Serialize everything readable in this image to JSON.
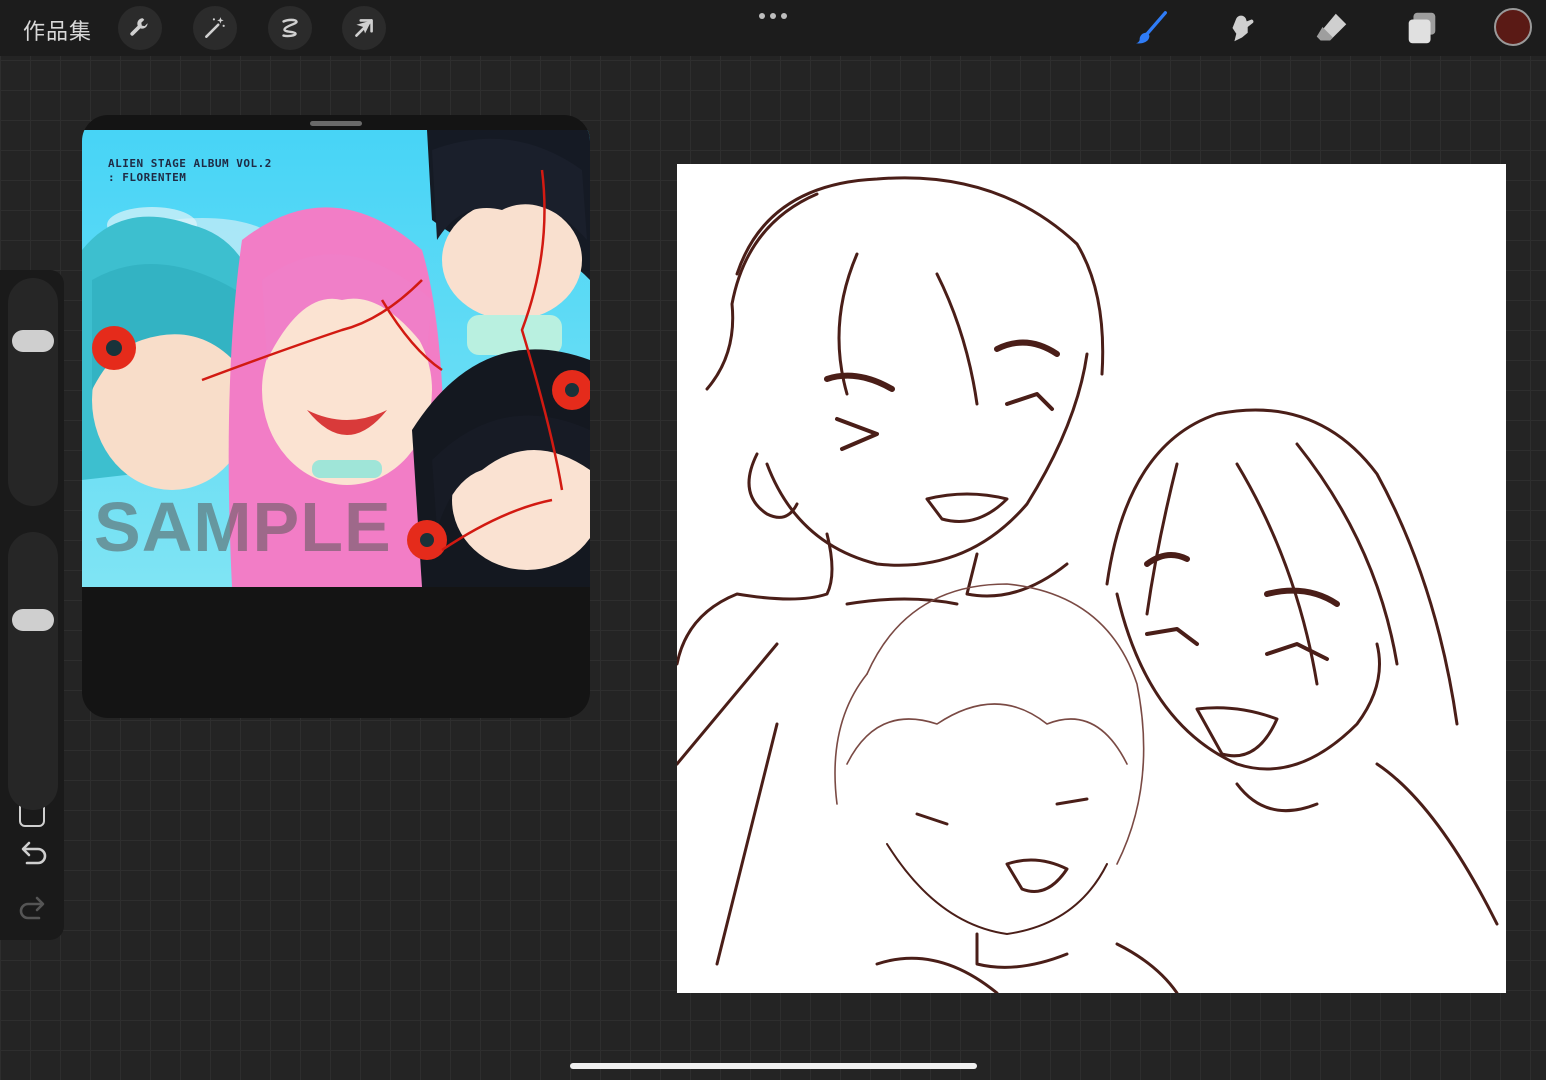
{
  "topbar": {
    "gallery_label": "作品集",
    "left_tools": [
      {
        "icon": "wrench-icon",
        "label": "Actions"
      },
      {
        "icon": "magic-wand-icon",
        "label": "Adjustments"
      },
      {
        "icon": "selection-icon",
        "label": "Selection"
      },
      {
        "icon": "transform-arrow-icon",
        "label": "Transform"
      }
    ],
    "more_icon": "ellipsis-icon",
    "right_tools": [
      {
        "icon": "brush-icon",
        "active": true
      },
      {
        "icon": "smudge-icon",
        "active": false
      },
      {
        "icon": "eraser-icon",
        "active": false
      },
      {
        "icon": "layers-icon",
        "active": false
      }
    ],
    "current_color": "#5a1a15",
    "active_tool_color": "#2f7cf6"
  },
  "sidebar": {
    "size_slider_level": 0.75,
    "opacity_slider_level": 0.7,
    "undo_icon": "undo-icon",
    "redo_icon": "redo-icon"
  },
  "reference": {
    "album_line1": "ALIEN STAGE ALBUM VOL.2",
    "album_line2": ": FLORENTEM",
    "watermark": "SAMPLE"
  },
  "canvas": {
    "line_color": "#4a1e18"
  }
}
